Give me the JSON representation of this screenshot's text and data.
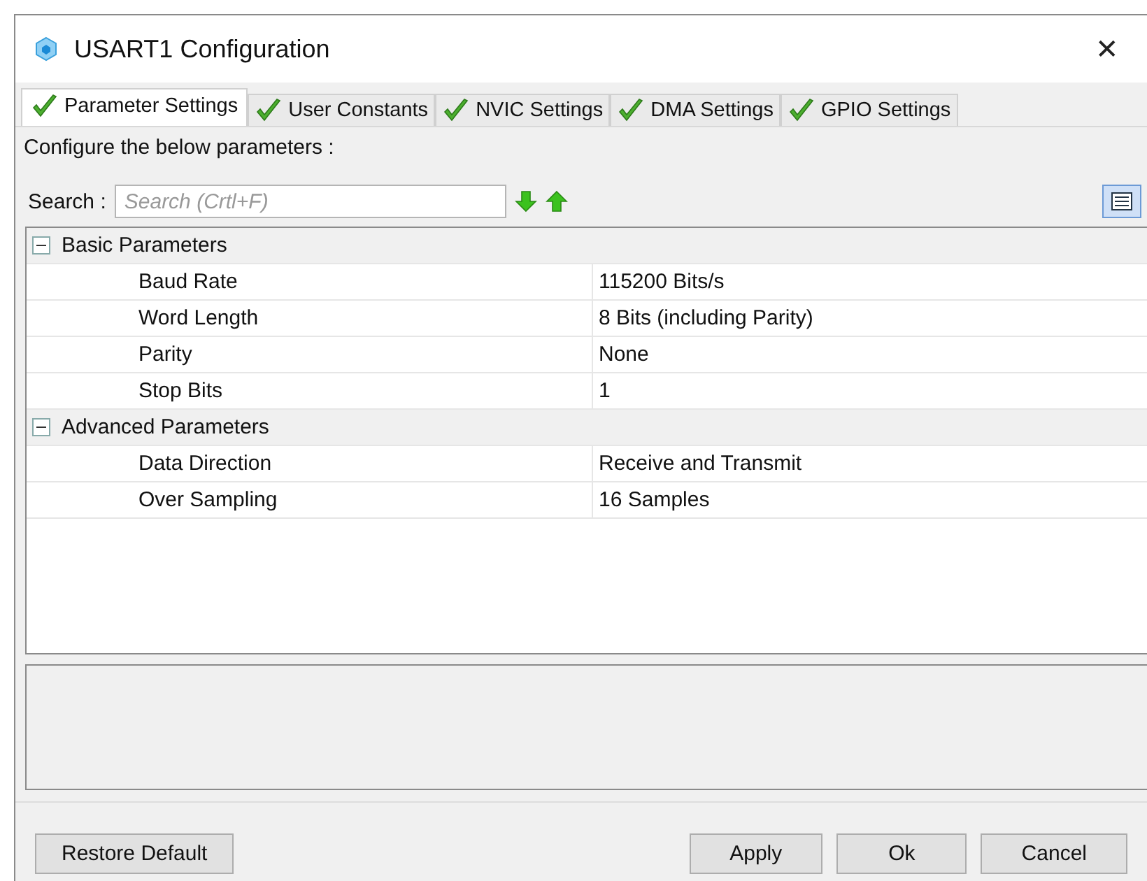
{
  "window": {
    "title": "USART1 Configuration",
    "close": "✕"
  },
  "tabs": [
    {
      "label": "Parameter Settings",
      "selected": true
    },
    {
      "label": "User Constants",
      "selected": false
    },
    {
      "label": "NVIC Settings",
      "selected": false
    },
    {
      "label": "DMA Settings",
      "selected": false
    },
    {
      "label": "GPIO Settings",
      "selected": false
    }
  ],
  "intro": "Configure the below parameters :",
  "search": {
    "label": "Search :",
    "placeholder": "Search (Crtl+F)"
  },
  "parameters": [
    {
      "name": "Basic Parameters",
      "expanded": true,
      "children": [
        {
          "name": "Baud Rate",
          "value": "115200 Bits/s"
        },
        {
          "name": "Word Length",
          "value": "8 Bits (including Parity)"
        },
        {
          "name": "Parity",
          "value": "None"
        },
        {
          "name": "Stop Bits",
          "value": "1"
        }
      ]
    },
    {
      "name": "Advanced Parameters",
      "expanded": true,
      "children": [
        {
          "name": "Data Direction",
          "value": "Receive and Transmit"
        },
        {
          "name": "Over Sampling",
          "value": "16 Samples"
        }
      ]
    }
  ],
  "buttons": {
    "left": [
      "Restore Default"
    ],
    "right": [
      "Apply",
      "Ok",
      "Cancel"
    ]
  }
}
